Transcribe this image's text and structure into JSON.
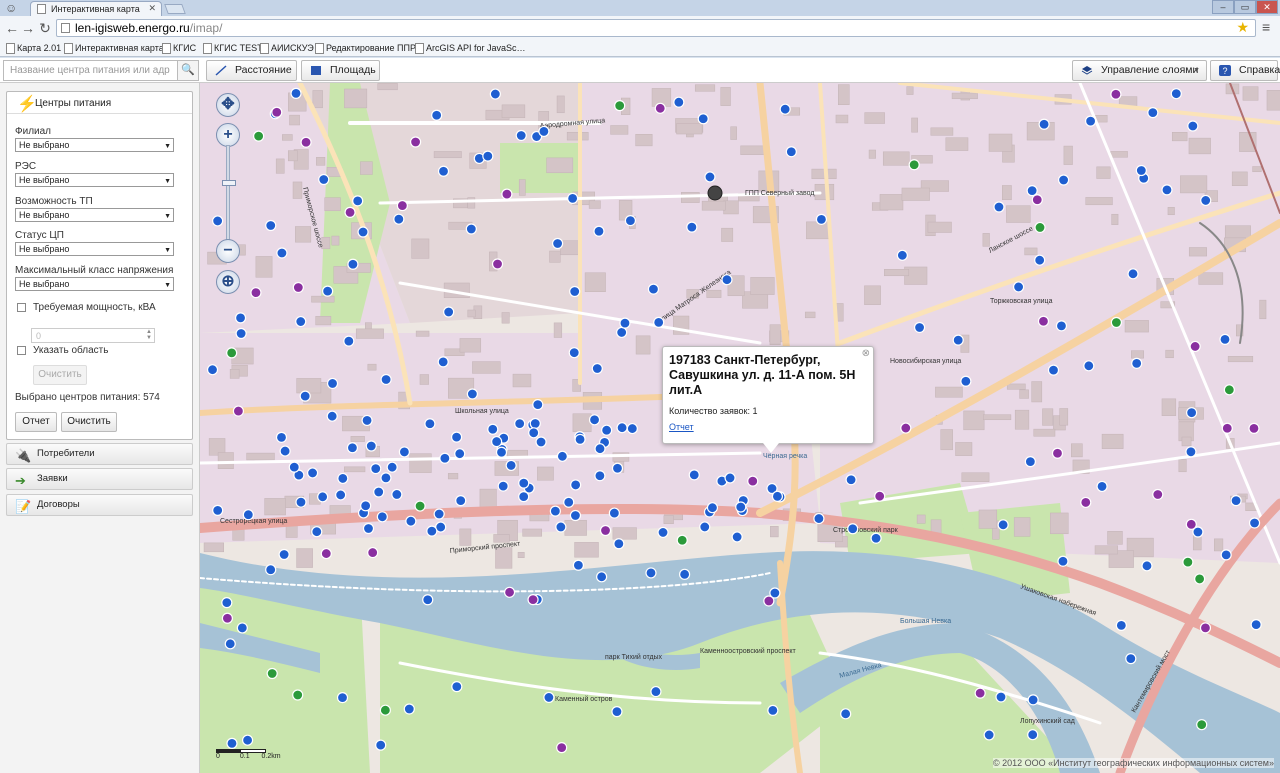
{
  "browser": {
    "tab_title": "Интерактивная карта",
    "url_host": "len-igisweb.energo.ru",
    "url_path": "/imap/",
    "bookmarks": [
      "Карта 2.01",
      "Интерактивная карта",
      "КГИС",
      "КГИС TEST",
      "АИИСКУЭ",
      "Редактирование ППР…",
      "ArcGIS API for JavaSc…"
    ]
  },
  "toolbar": {
    "search_placeholder": "Название центра питания или адрес",
    "distance_label": "Расстояние",
    "area_label": "Площадь",
    "layers_label": "Управление слоями",
    "help_label": "Справка"
  },
  "sidebar": {
    "panel_title": "Центры питания",
    "filters": [
      {
        "label": "Филиал",
        "value": "Не выбрано"
      },
      {
        "label": "РЭС",
        "value": "Не выбрано"
      },
      {
        "label": "Возможность ТП",
        "value": "Не выбрано"
      },
      {
        "label": "Статус ЦП",
        "value": "Не выбрано"
      },
      {
        "label": "Максимальный класс напряжения",
        "value": "Не выбрано"
      }
    ],
    "power_label": "Требуемая мощность, кВА",
    "power_placeholder": "0",
    "area_label": "Указать область",
    "clear_area_label": "Очистить",
    "count_text": "Выбрано центров питания: 574",
    "report_label": "Отчет",
    "clear_label": "Очистить",
    "sections": [
      "Потребители",
      "Заявки",
      "Договоры"
    ]
  },
  "map": {
    "popup": {
      "title": "197183 Санкт-Петербург, Савушкина ул. д. 11-А пом. 5Н лит.А",
      "count_text": "Количество заявок: 1",
      "link_text": "Отчет"
    },
    "scale_labels": [
      "0",
      "0.1",
      "0.2km"
    ],
    "attribution": "© 2012 ООО «Институт географических информационных систем»",
    "labels": [
      "Ланское шоссе",
      "Приморский проспект",
      "Ушаковская набережная",
      "Каменный остров",
      "парк Тихий отдых",
      "Строгановский парк",
      "ГПП Северный завод",
      "Большая Невка",
      "Аэродромная улица",
      "улица Матроса Железняка",
      "Чёрная речка",
      "Лопухинский сад",
      "Каменноостровский проспект",
      "Школьная улица",
      "Новосибирская улица",
      "Торжковская улица",
      "Сестрорецкая улица",
      "Кантемировский мост",
      "Малая Невка",
      "Приморское шоссе"
    ],
    "colors": {
      "water": "#a6c2d6",
      "park": "#c9e5ad",
      "residential": "#e9d9e6",
      "industrial": "#ddd0cc",
      "building": "#d1c6c2",
      "road_major": "#e9a6a0",
      "road_secondary": "#f6d2a1"
    }
  }
}
